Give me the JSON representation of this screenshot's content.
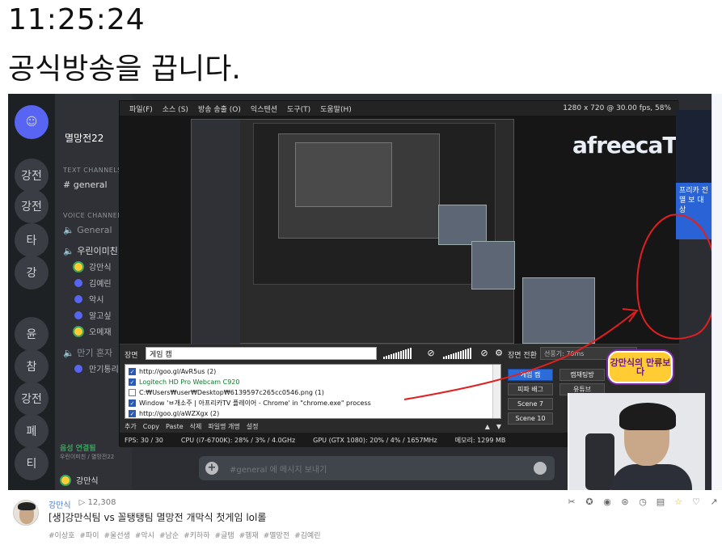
{
  "clock": "11:25:24",
  "headline": "공식방송을 끕니다.",
  "discord": {
    "server_name": "멸망전22",
    "servers": [
      "강전",
      "강전",
      "타",
      "강",
      "윤",
      "참",
      "강전",
      "폐",
      "티"
    ],
    "text_category": "TEXT CHANNELS",
    "text_channel": "general",
    "voice_category": "VOICE CHANNELS",
    "voice_general": "General",
    "voice_room": "우린이미친",
    "users": [
      "강만식",
      "김예린",
      "악시",
      "알고싶",
      "오메재"
    ],
    "voice_room2": "만기 혼자",
    "users2": [
      "만기통리"
    ],
    "voice_status": "음성 연결됨",
    "voice_sub": "우린이미친 / 멸망전22",
    "me": "강만식",
    "chat_placeholder": "#general 에 메시지 보내기"
  },
  "obs": {
    "menu": [
      "파일(F)",
      "소스 (S)",
      "방송 송출 (O)",
      "익스텐션",
      "도구(T)",
      "도움말(H)"
    ],
    "resolution": "1280 x 720 @ 30.00 fps, 58%",
    "scene_label": "장면",
    "scene_name": "게임 캠",
    "switch_label": "장면 전환",
    "switch_value": "선풍기: 70ms",
    "sources": [
      {
        "checked": true,
        "text": "http://goo.gl/AvR5us (2)",
        "green": false
      },
      {
        "checked": true,
        "text": "Logitech HD Pro Webcam C920",
        "green": true
      },
      {
        "checked": false,
        "text": "C:₩Users₩user₩Desktop₩6139597c265cc0546.png (1)",
        "green": false
      },
      {
        "checked": true,
        "text": "Window 'ㅂ개소주 | 아프리카TV 플레이어 - Chrome' in \"chrome.exe\" process",
        "green": false
      },
      {
        "checked": true,
        "text": "http://goo.gl/aWZXgx (2)",
        "green": false
      }
    ],
    "source_tools": [
      "추가",
      "Copy",
      "Paste",
      "삭제",
      "파일명 개명",
      "설정"
    ],
    "scenes": [
      "게임 캠",
      "캠채팅방",
      "피파 배그",
      "유튜브",
      "Scene 7",
      "Scene 10"
    ],
    "status": [
      "FPS: 30 / 30",
      "CPU (i7-6700K): 28% / 3% / 4.0GHz",
      "GPU (GTX 1080): 20% / 4% / 1657MHz",
      "메모리: 1299 MB"
    ]
  },
  "overlay": {
    "brand": "afreecaTV",
    "badge": "강만식의 만류보다",
    "side_tag": "프리카 전 멸 보 대상"
  },
  "video": {
    "channel": "강만식",
    "views": "▷ 12,308",
    "title": "[생]강만식팀 vs 꼴탱탱팀 멸망전 개막식 첫게임 lol롤",
    "tags": [
      "#이상호",
      "#파이",
      "#울선생",
      "#악시",
      "#남순",
      "#키하하",
      "#글탬",
      "#헹재",
      "#멸망전",
      "#김예린"
    ],
    "action_icons": [
      "clip-icon",
      "star-badge-icon",
      "ad-icon",
      "share-alt-icon",
      "clock-icon",
      "subtitle-icon",
      "favorite-star-icon",
      "like-icon",
      "share-icon"
    ]
  },
  "colors": {
    "accent_blue": "#2b6cd9",
    "annotation_red": "#e02020",
    "badge_yellow": "#ffcc33"
  }
}
